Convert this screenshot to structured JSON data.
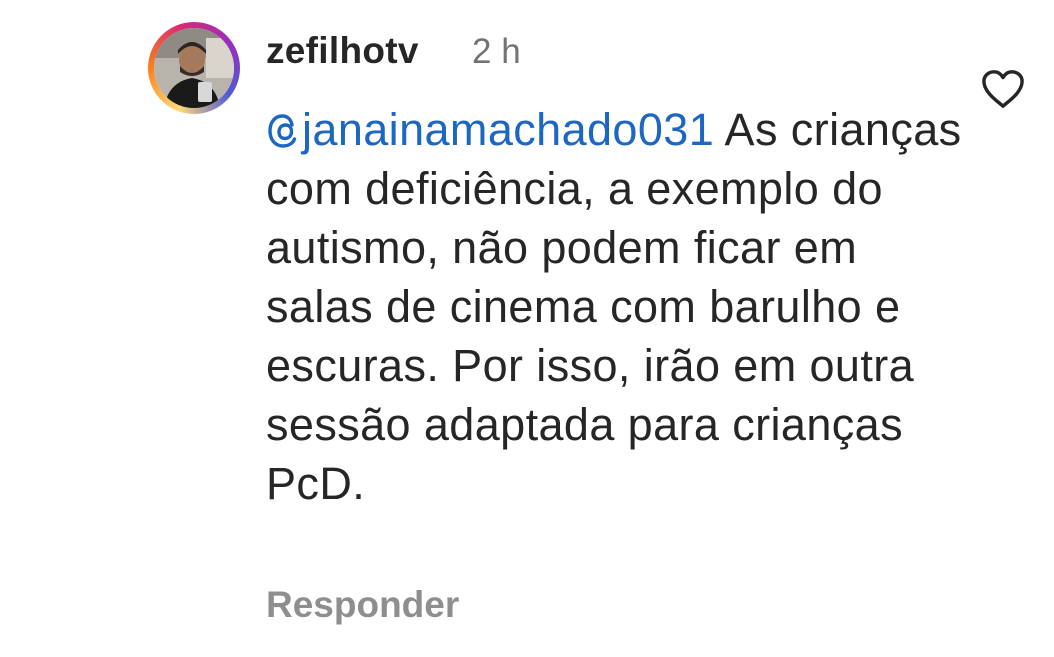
{
  "comment": {
    "username": "zefilhotv",
    "time": "2 h",
    "mention": "janainamachado031",
    "text": " As crianças com deficiência, a exemplo do autismo, não podem ficar em salas de cinema com barulho e escuras. Por isso, irão em outra sessão adaptada para crianças PcD.",
    "reply_label": "Responder"
  },
  "icons": {
    "like": "heart-outline-icon",
    "mention_prefix": "threads-at-icon"
  },
  "colors": {
    "mention": "#1b67c2",
    "text": "#262626",
    "meta": "#737373",
    "reply": "#8e8e8e"
  }
}
